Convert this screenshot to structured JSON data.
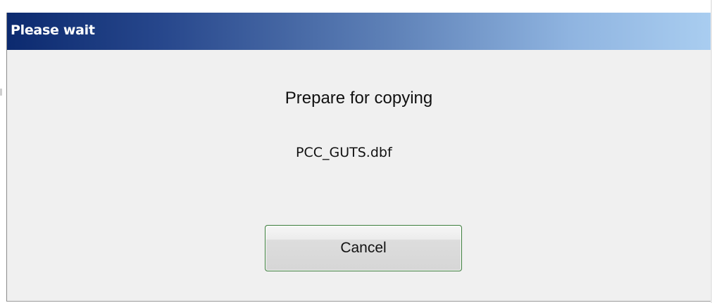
{
  "dialog": {
    "title": "Please wait",
    "message": "Prepare for copying",
    "filename": "PCC_GUTS.dbf",
    "cancel_label": "Cancel"
  },
  "colors": {
    "titlebar_start": "#0c2a6f",
    "titlebar_end": "#a9cdf0",
    "dialog_bg": "#f0f0f0",
    "button_border": "#3c7a3c"
  }
}
